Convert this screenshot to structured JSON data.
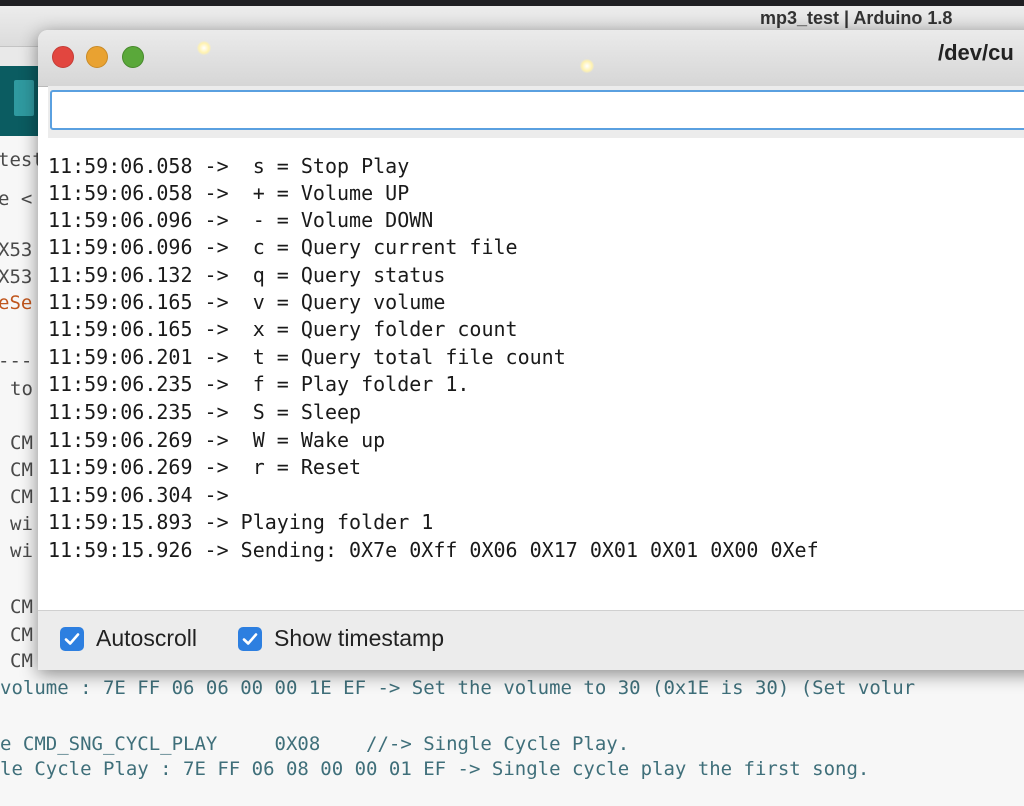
{
  "background_ide": {
    "title": "mp3_test | Arduino 1.8",
    "left_gutter": [
      "test",
      "e <",
      "X53",
      "X53",
      "eSe",
      "---",
      "to",
      "CM",
      "CM",
      "CM",
      "wi",
      "wi",
      "CM",
      "CM",
      "CM"
    ],
    "code_lines": [
      {
        "text": "volume : 7E FF 06 06 00 00 1E EF -> Set the volume to 30 (0x1E is 30) (Set volur",
        "kind": "text"
      },
      {
        "text": "e CMD_SNG_CYCL_PLAY     0X08    //-> Single Cycle Play.",
        "kind": "text"
      },
      {
        "text": "le Cycle Play : 7E FF 06 08 00 00 01 EF -> Single cycle play the first song.",
        "kind": "text"
      }
    ]
  },
  "monitor": {
    "title": "/dev/cu",
    "send_input": {
      "value": "",
      "placeholder": ""
    },
    "output_lines": [
      "11:59:06.058 ->  s = Stop Play",
      "11:59:06.058 ->  + = Volume UP",
      "11:59:06.096 ->  - = Volume DOWN",
      "11:59:06.096 ->  c = Query current file",
      "11:59:06.132 ->  q = Query status",
      "11:59:06.165 ->  v = Query volume",
      "11:59:06.165 ->  x = Query folder count",
      "11:59:06.201 ->  t = Query total file count",
      "11:59:06.235 ->  f = Play folder 1.",
      "11:59:06.235 ->  S = Sleep",
      "11:59:06.269 ->  W = Wake up",
      "11:59:06.269 ->  r = Reset",
      "11:59:06.304 -> ",
      "11:59:15.893 -> Playing folder 1",
      "11:59:15.926 -> Sending: 0X7e 0Xff 0X06 0X17 0X01 0X01 0X00 0Xef"
    ],
    "autoscroll": {
      "label": "Autoscroll",
      "checked": true
    },
    "show_timestamp": {
      "label": "Show timestamp",
      "checked": true
    }
  },
  "colors": {
    "close": "#e2463f",
    "minimize": "#e9a231",
    "zoom": "#5aa83a",
    "checkbox": "#2d7fe0",
    "input_border": "#5aa0e0"
  }
}
